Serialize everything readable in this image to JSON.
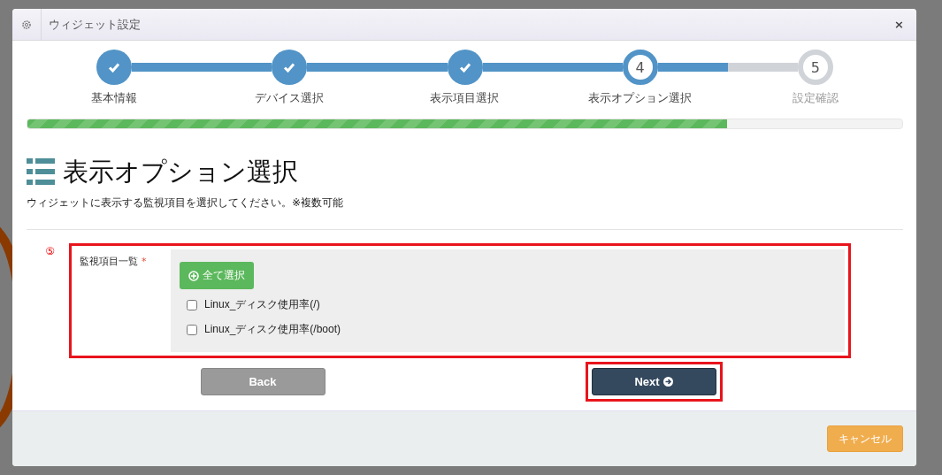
{
  "window": {
    "title": "ウィジェット設定",
    "close": "×"
  },
  "steps": [
    {
      "label": "基本情報",
      "completed": true
    },
    {
      "label": "デバイス選択",
      "completed": true
    },
    {
      "label": "表示項目選択",
      "completed": true
    },
    {
      "label": "表示オプション選択",
      "number": "4",
      "completed": false,
      "active": true
    },
    {
      "label": "設定確認",
      "number": "5",
      "completed": false,
      "active": false
    }
  ],
  "progress": {
    "level": 0.8
  },
  "heading": "表示オプション選択",
  "description": "ウィジェットに表示する監視項目を選択してください。※複数可能",
  "field": {
    "marker": "⑤",
    "label": "監視項目一覧",
    "required_mark": "*",
    "highlighted": true,
    "select_all": "全て選択",
    "options": [
      {
        "label": "Linux_ディスク使用率(/)",
        "checked": false
      },
      {
        "label": "Linux_ディスク使用率(/boot)",
        "checked": false
      }
    ]
  },
  "buttons": [
    {
      "label": "Back",
      "kind": "back"
    },
    {
      "label": "Next",
      "kind": "next",
      "highlighted": true
    }
  ],
  "footer": {
    "cancel": "キャンセル"
  }
}
